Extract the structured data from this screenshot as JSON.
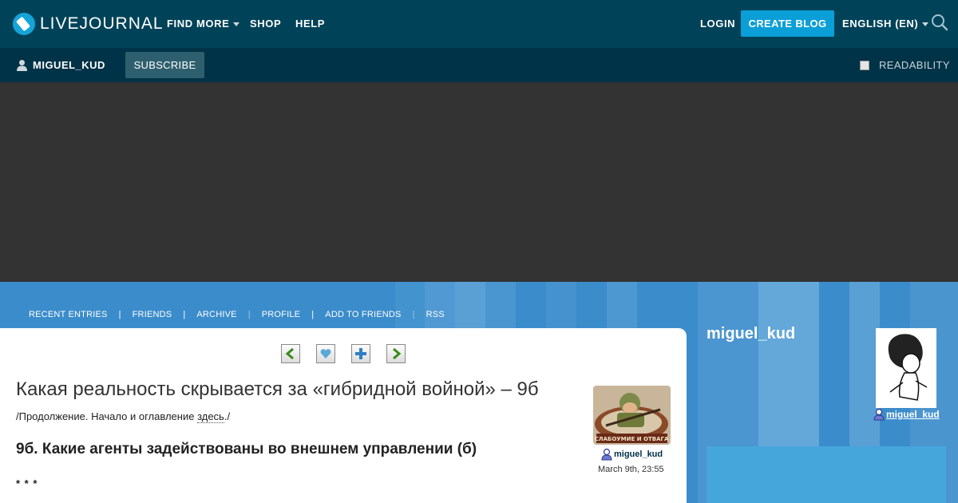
{
  "header": {
    "logo_text": "LIVEJOURNAL",
    "nav": [
      {
        "label": "FIND MORE",
        "has_dropdown": true
      },
      {
        "label": "SHOP",
        "has_dropdown": false
      },
      {
        "label": "HELP",
        "has_dropdown": false
      }
    ],
    "login_label": "LOGIN",
    "create_blog_label": "CREATE BLOG",
    "language_label": "ENGLISH (EN)",
    "search_icon": "search-icon"
  },
  "subbar": {
    "username": "MIGUEL_KUD",
    "subscribe_label": "SUBSCRIBE",
    "readability_label": "READABILITY",
    "readability_checked": false
  },
  "journal_nav": [
    "RECENT ENTRIES",
    "FRIENDS",
    "ARCHIVE",
    "PROFILE",
    "ADD TO FRIENDS",
    "RSS"
  ],
  "post": {
    "nav_icons": [
      "prev-arrow-icon",
      "heart-icon",
      "plus-icon",
      "next-arrow-icon"
    ],
    "title": "Какая реальность скрывается за «гибридной войной» – 9б",
    "intro_prefix": "/Продолжение. Начало и оглавление ",
    "intro_link": "здесь",
    "intro_suffix": "./",
    "subtitle": "9б. Какие агенты задействованы во внешнем управлении (б)",
    "stars": "* * *",
    "author": "miguel_kud",
    "date": "March 9th, 23:55",
    "avatar_caption": "СЛАБОУМИЕ И ОТВАГА"
  },
  "sidebar": {
    "journal_name": "miguel_kud",
    "user_link": "miguel_kud"
  },
  "colors": {
    "topbar": "#004359",
    "subbar": "#003347",
    "accent_button": "#0b9fd8",
    "ad_area": "#333333",
    "journal_blue": "#3b8ccb"
  }
}
